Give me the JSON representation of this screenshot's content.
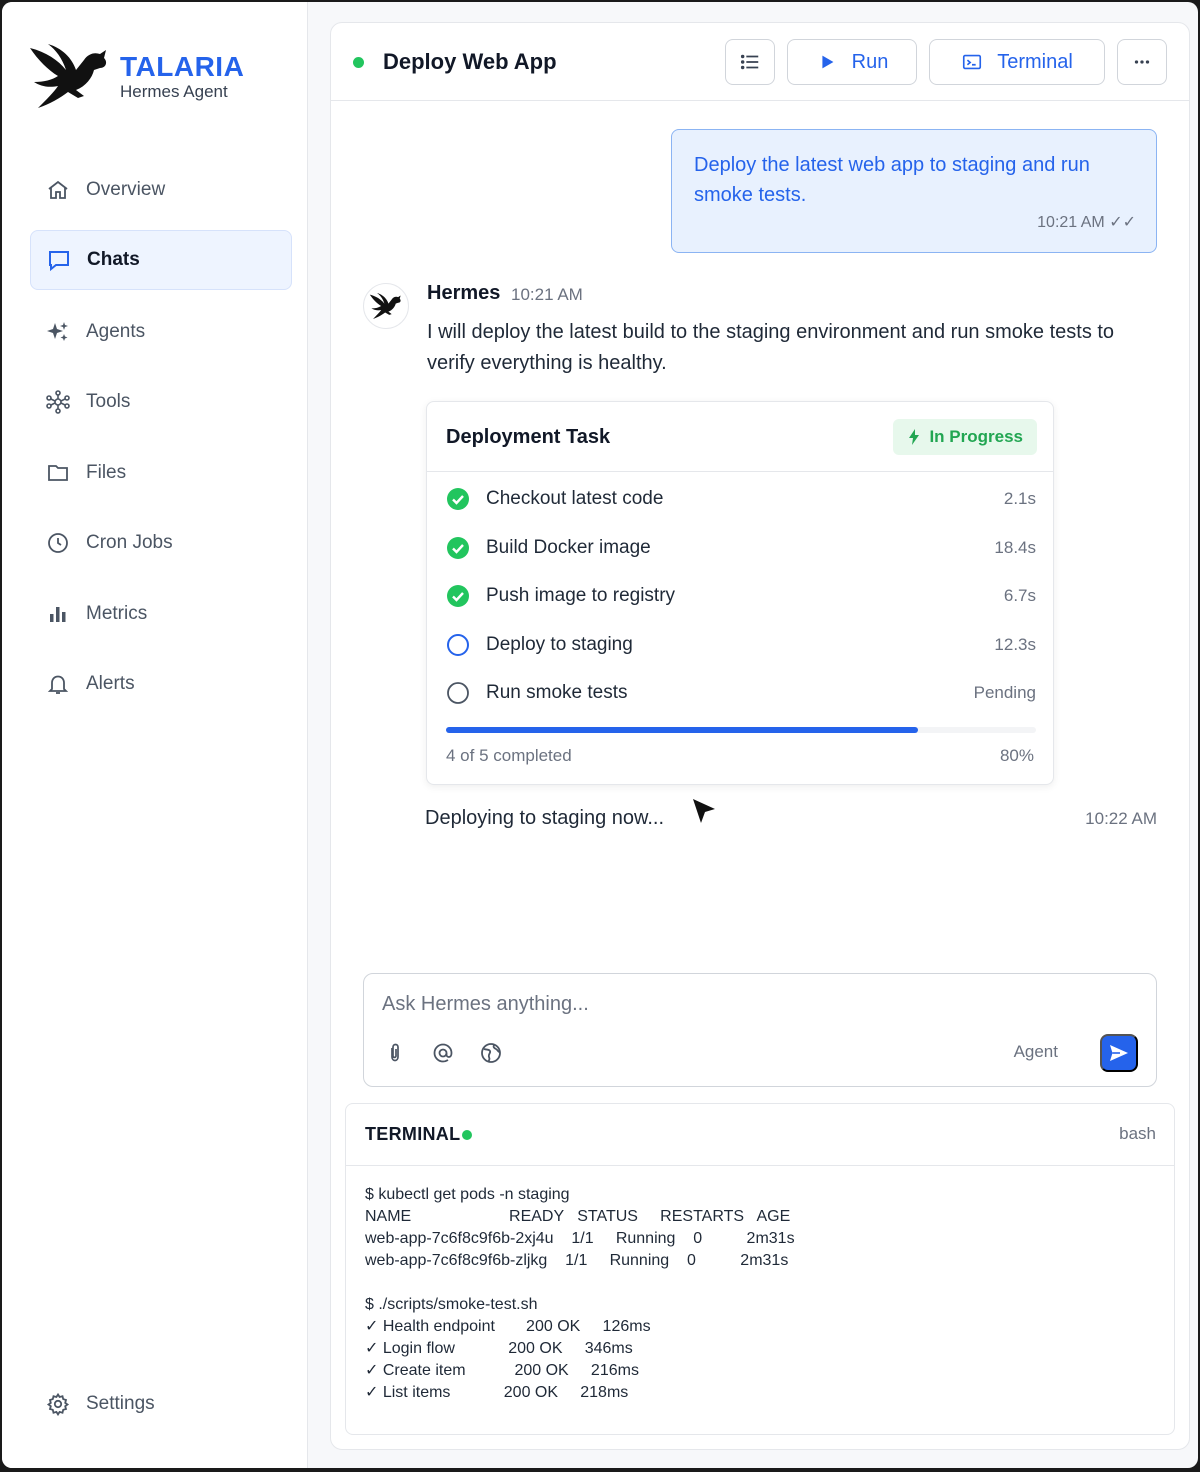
{
  "brand": {
    "title": "TALARIA",
    "subtitle": "Hermes Agent"
  },
  "sidebar": {
    "items": [
      {
        "label": "Overview",
        "icon": "home-icon",
        "active": false
      },
      {
        "label": "Chats",
        "icon": "chat-icon",
        "active": true
      },
      {
        "label": "Agents",
        "icon": "sparkles-icon",
        "active": false
      },
      {
        "label": "Tools",
        "icon": "network-icon",
        "active": false
      },
      {
        "label": "Files",
        "icon": "folder-icon",
        "active": false
      },
      {
        "label": "Cron Jobs",
        "icon": "clock-icon",
        "active": false
      },
      {
        "label": "Metrics",
        "icon": "bar-chart-icon",
        "active": false
      },
      {
        "label": "Alerts",
        "icon": "bell-icon",
        "active": false
      }
    ],
    "settings_label": "Settings"
  },
  "header": {
    "title": "Deploy Web App",
    "status_color": "#22c55e",
    "run_label": "Run",
    "terminal_label": "Terminal"
  },
  "user_message": {
    "text": "Deploy the latest web app to staging and run smoke tests.",
    "time": "10:21 AM ✓✓"
  },
  "assistant": {
    "name": "Hermes",
    "time": "10:21 AM",
    "text": "I will deploy the latest build to the staging environment and run smoke tests to verify everything is healthy."
  },
  "task": {
    "title": "Deployment Task",
    "status": "In Progress",
    "steps": [
      {
        "label": "Checkout latest code",
        "duration": "2.1s",
        "state": "done"
      },
      {
        "label": "Build Docker image",
        "duration": "18.4s",
        "state": "done"
      },
      {
        "label": "Push image to registry",
        "duration": "6.7s",
        "state": "done"
      },
      {
        "label": "Deploy to staging",
        "duration": "12.3s",
        "state": "running"
      },
      {
        "label": "Run smoke tests",
        "duration": "Pending",
        "state": "pending"
      }
    ],
    "progress_text": "4 of 5 completed",
    "progress_pct_label": "80%",
    "progress_fraction": 0.8
  },
  "status_message": {
    "text": "Deploying to staging now...",
    "time": "10:22 AM"
  },
  "composer": {
    "placeholder": "Ask Hermes anything...",
    "mode": "Agent"
  },
  "terminal": {
    "title": "TERMINAL",
    "shell": "bash",
    "lines": [
      "$ kubectl get pods -n staging",
      "NAME                      READY   STATUS     RESTARTS   AGE",
      "web-app-7c6f8c9f6b-2xj4u    1/1     Running    0          2m31s",
      "web-app-7c6f8c9f6b-zljkg    1/1     Running    0          2m31s",
      "",
      "$ ./scripts/smoke-test.sh",
      "✓ Health endpoint       200 OK     126ms",
      "✓ Login flow            200 OK     346ms",
      "✓ Create item           200 OK     216ms",
      "✓ List items            200 OK     218ms"
    ]
  },
  "colors": {
    "accent": "#2563eb",
    "success": "#22c55e"
  }
}
